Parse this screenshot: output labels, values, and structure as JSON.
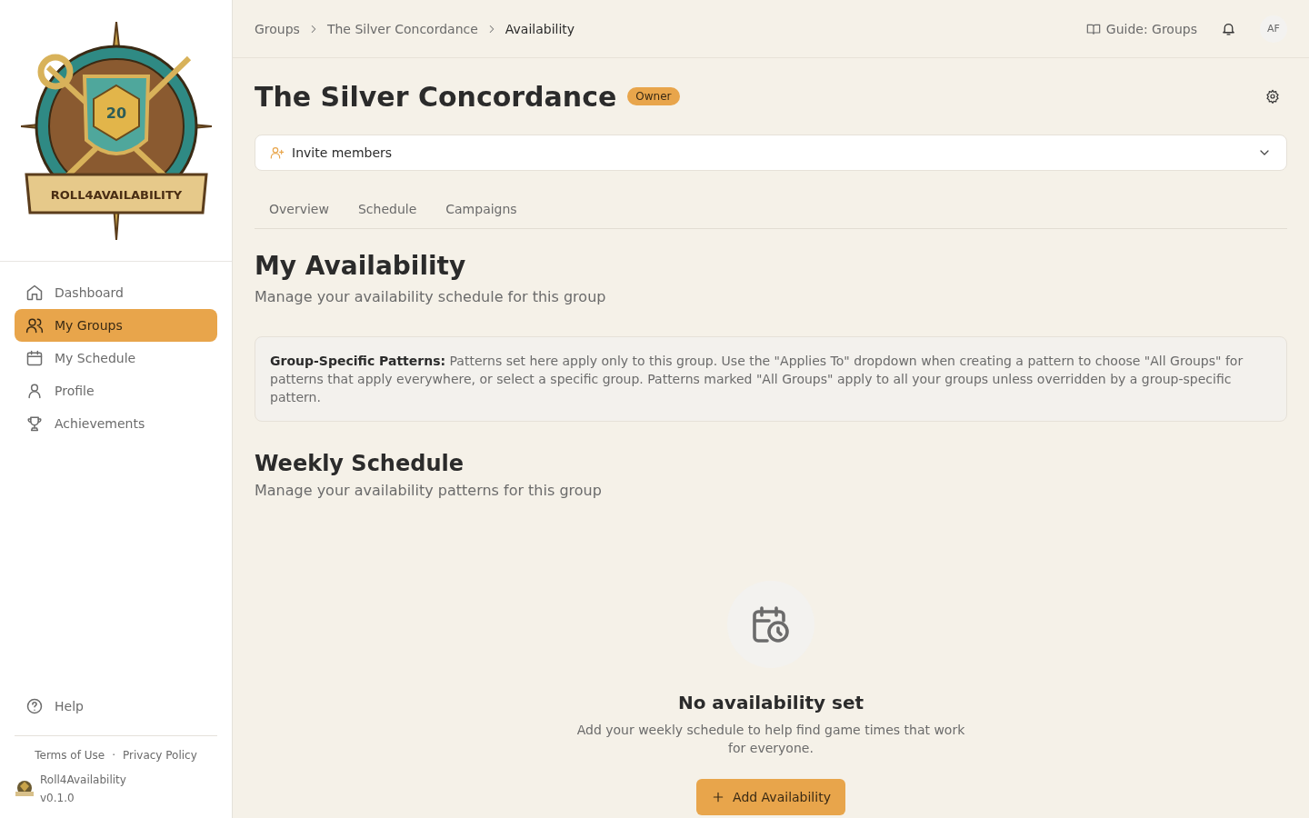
{
  "sidebar": {
    "logo": {
      "banner": "ROLL4AVAILABILITY",
      "die": "20"
    },
    "items": [
      {
        "label": "Dashboard",
        "selected": false
      },
      {
        "label": "My Groups",
        "selected": true
      },
      {
        "label": "My Schedule",
        "selected": false
      },
      {
        "label": "Profile",
        "selected": false
      },
      {
        "label": "Achievements",
        "selected": false
      }
    ],
    "help": {
      "label": "Help",
      "selected": false
    },
    "footer_links": [
      "Terms of Use",
      "Privacy Policy"
    ],
    "footer_separator": "·",
    "app_name": "Roll4Availability",
    "version": "v0.1.0"
  },
  "breadcrumbs": [
    "Groups",
    "The Silver Concordance",
    "Availability"
  ],
  "topbar": {
    "guide": "Guide: Groups",
    "avatar": "AF"
  },
  "group": {
    "title": "The Silver Concordance",
    "role": "Owner",
    "invite": "Invite members"
  },
  "tabs": [
    {
      "label": "Overview",
      "selected": false
    },
    {
      "label": "Schedule",
      "selected": false
    },
    {
      "label": "Campaigns",
      "selected": false
    }
  ],
  "availability": {
    "title": "My Availability",
    "subtitle": "Manage your availability schedule for this group",
    "note": "**Group-Specific Patterns:** Patterns set here apply only to this group. Use the \"Applies To\" dropdown when creating a pattern to choose \"All Groups\" for patterns that apply everywhere, or select a specific group. Patterns marked \"All Groups\" apply to all your groups unless overridden by a group-specific pattern."
  },
  "weekly": {
    "title": "Weekly Schedule",
    "subtitle": "Manage your availability patterns for this group",
    "empty": {
      "title": "No availability set",
      "text": "Add your weekly schedule to help find game times that work for everyone.",
      "button": "Add Availability"
    }
  }
}
